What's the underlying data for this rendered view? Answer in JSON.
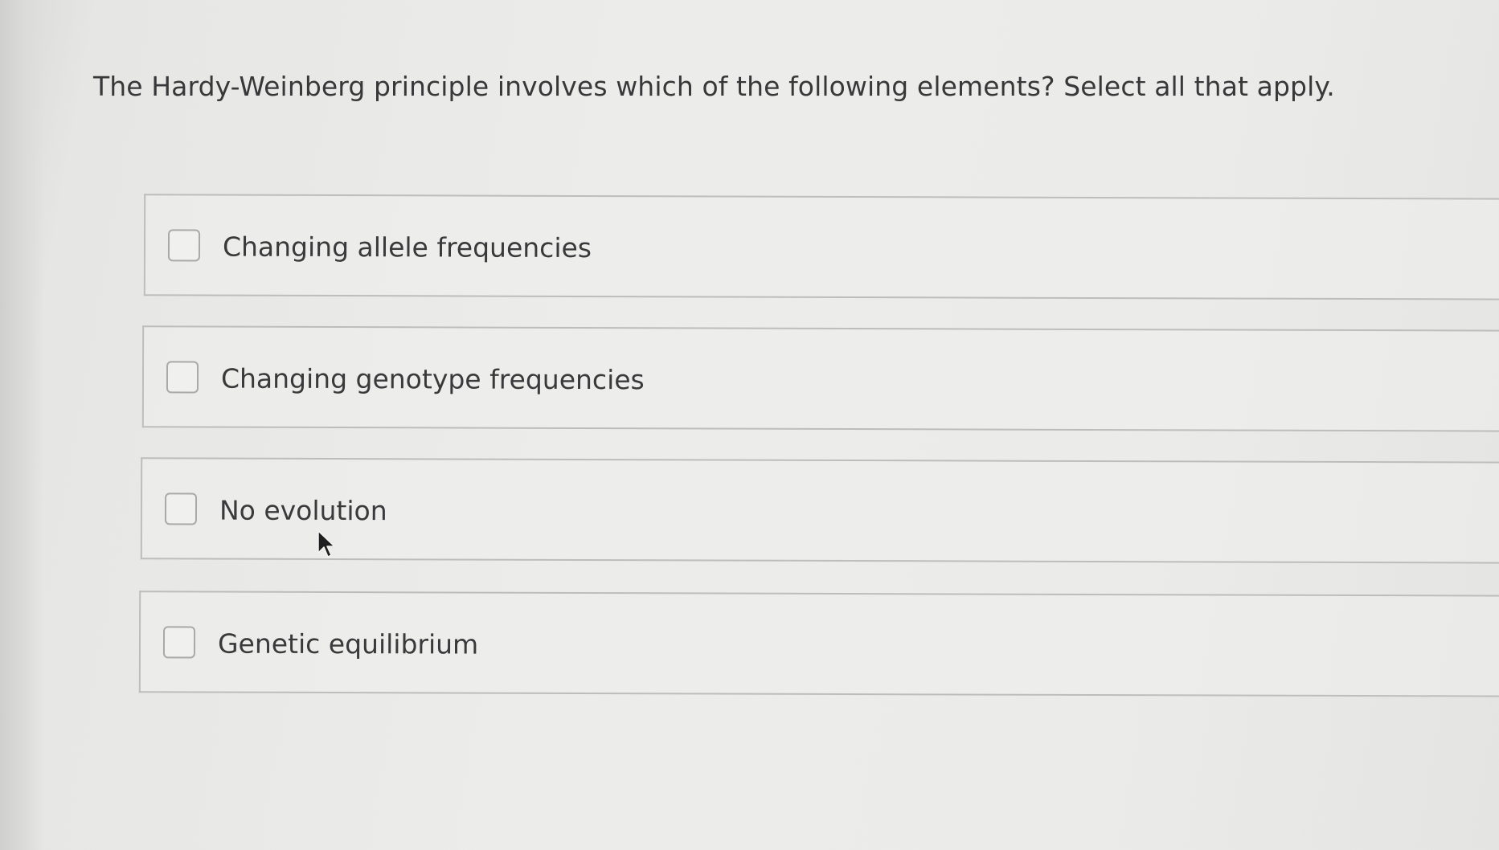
{
  "question": {
    "text": "The Hardy-Weinberg principle involves which of the following elements? Select all that apply."
  },
  "options": [
    {
      "label": "Changing allele frequencies",
      "checked": false
    },
    {
      "label": "Changing genotype frequencies",
      "checked": false
    },
    {
      "label": "No evolution",
      "checked": false
    },
    {
      "label": "Genetic equilibrium",
      "checked": false
    }
  ],
  "cursor": {
    "icon": "mouse-pointer-icon"
  }
}
